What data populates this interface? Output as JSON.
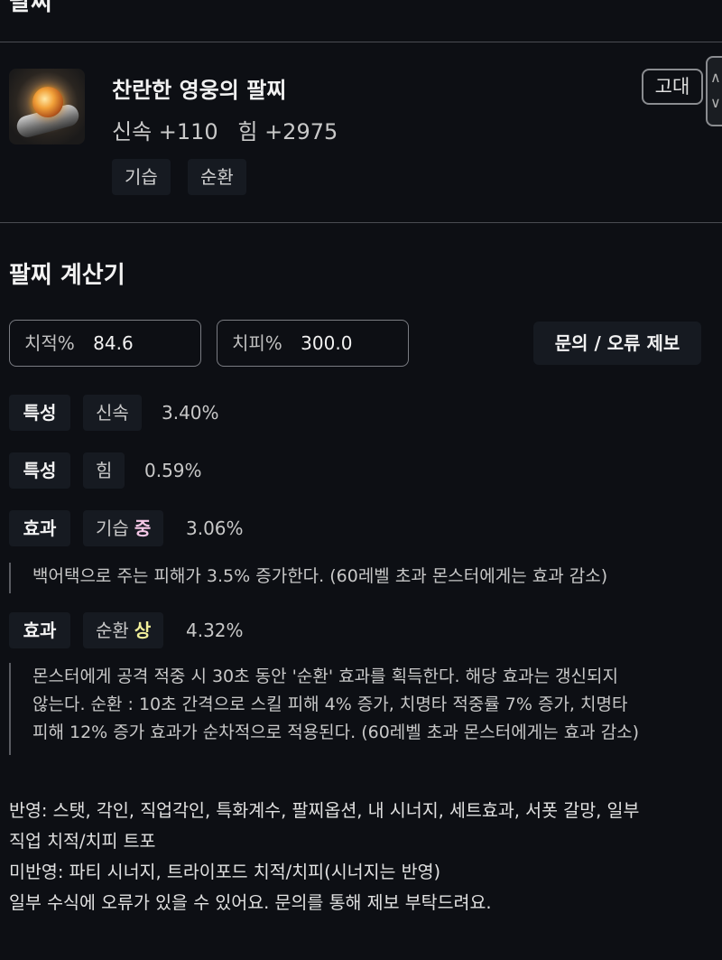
{
  "header": {
    "title": "팔찌"
  },
  "item": {
    "name": "찬란한 영웅의 팔찌",
    "stats": [
      "신속 +110",
      "힘 +2975"
    ],
    "tags": [
      "기습",
      "순환"
    ],
    "grade": "고대",
    "icon": "bracelet-icon"
  },
  "calculator": {
    "title": "팔찌 계산기",
    "crit_rate": {
      "label": "치적%",
      "value": "84.6"
    },
    "crit_dmg": {
      "label": "치피%",
      "value": "300.0"
    },
    "report_button": "문의 / 오류 제보",
    "rows": [
      {
        "kind": "특성",
        "name": "신속",
        "grade": "",
        "value": "3.40%"
      },
      {
        "kind": "특성",
        "name": "힘",
        "grade": "",
        "value": "0.59%"
      },
      {
        "kind": "효과",
        "name": "기습",
        "grade": "중",
        "value": "3.06%",
        "desc": "백어택으로 주는 피해가 3.5% 증가한다. (60레벨 초과 몬스터에게는 효과 감소)"
      },
      {
        "kind": "효과",
        "name": "순환",
        "grade": "상",
        "value": "4.32%",
        "desc_lines": [
          "몬스터에게 공격 적중 시 30초 동안 '순환' 효과를 획득한다. 해당 효과는 갱신되지",
          "않는다. 순환 : 10초 간격으로 스킬 피해 4% 증가, 치명타 적중률 7% 증가, 치명타",
          "피해 12% 증가 효과가 순차적으로 적용된다. (60레벨 초과 몬스터에게는 효과 감소)"
        ]
      }
    ]
  },
  "footer": {
    "lines": [
      "반영: 스탯, 각인, 직업각인, 특화계수, 팔찌옵션, 내 시너지, 세트효과, 서폿 갈망, 일부",
      "직업 치적/치피 트포",
      "미반영: 파티 시너지, 트라이포드 치적/치피(시너지는 반영)",
      "일부 수식에 오류가 있을 수 있어요. 문의를 통해 제보 부탁드려요."
    ]
  },
  "colors": {
    "background": "#0d0f14",
    "grade_mid": "#f4c7e6",
    "grade_high": "#f1ef9a"
  }
}
